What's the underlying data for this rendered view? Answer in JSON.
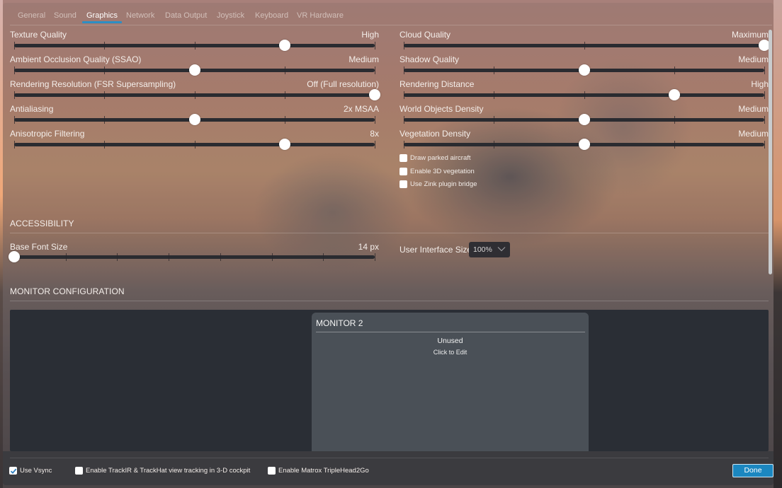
{
  "tabs": [
    {
      "label": "General",
      "active": false
    },
    {
      "label": "Sound",
      "active": false
    },
    {
      "label": "Graphics",
      "active": true
    },
    {
      "label": "Network",
      "active": false
    },
    {
      "label": "Data Output",
      "active": false
    },
    {
      "label": "Joystick",
      "active": false
    },
    {
      "label": "Keyboard",
      "active": false
    },
    {
      "label": "VR Hardware",
      "active": false
    }
  ],
  "graphics": {
    "left": [
      {
        "label": "Texture Quality",
        "value": "High",
        "steps": 5,
        "position": 3
      },
      {
        "label": "Ambient Occlusion Quality (SSAO)",
        "value": "Medium",
        "steps": 5,
        "position": 2
      },
      {
        "label": "Rendering Resolution (FSR Supersampling)",
        "value": "Off (Full resolution)",
        "steps": 5,
        "position": 4
      },
      {
        "label": "Antialiasing",
        "value": "2x MSAA",
        "steps": 5,
        "position": 2
      },
      {
        "label": "Anisotropic Filtering",
        "value": "8x",
        "steps": 5,
        "position": 3
      }
    ],
    "right": [
      {
        "label": "Cloud Quality",
        "value": "Maximum",
        "steps": 3,
        "position": 2
      },
      {
        "label": "Shadow Quality",
        "value": "Medium",
        "steps": 5,
        "position": 2
      },
      {
        "label": "Rendering Distance",
        "value": "High",
        "steps": 5,
        "position": 3
      },
      {
        "label": "World Objects Density",
        "value": "Medium",
        "steps": 5,
        "position": 2
      },
      {
        "label": "Vegetation Density",
        "value": "Medium",
        "steps": 5,
        "position": 2
      }
    ],
    "checkboxes": [
      {
        "label": "Draw parked aircraft",
        "checked": false
      },
      {
        "label": "Enable 3D vegetation",
        "checked": false
      },
      {
        "label": "Use Zink plugin bridge",
        "checked": false
      }
    ]
  },
  "accessibility": {
    "title": "ACCESSIBILITY",
    "base_font_size": {
      "label": "Base Font Size",
      "value": "14 px",
      "steps": 8,
      "position": 0
    },
    "ui_size": {
      "label": "User Interface Size",
      "selected": "100%"
    }
  },
  "monitor_config": {
    "title": "MONITOR CONFIGURATION",
    "monitor": {
      "title": "MONITOR 2",
      "status": "Unused",
      "hint": "Click to Edit"
    }
  },
  "footer": {
    "checkboxes": [
      {
        "label": "Use Vsync",
        "checked": true
      },
      {
        "label": "Enable TrackIR & TrackHat view tracking in 3-D cockpit",
        "checked": false
      },
      {
        "label": "Enable Matrox TripleHead2Go",
        "checked": false
      }
    ],
    "done_label": "Done"
  },
  "colors": {
    "accent": "#2d8ec4",
    "done_button": "#1b87c0",
    "monitor_area": "#2a2e35",
    "monitor_card": "#4a5057"
  }
}
